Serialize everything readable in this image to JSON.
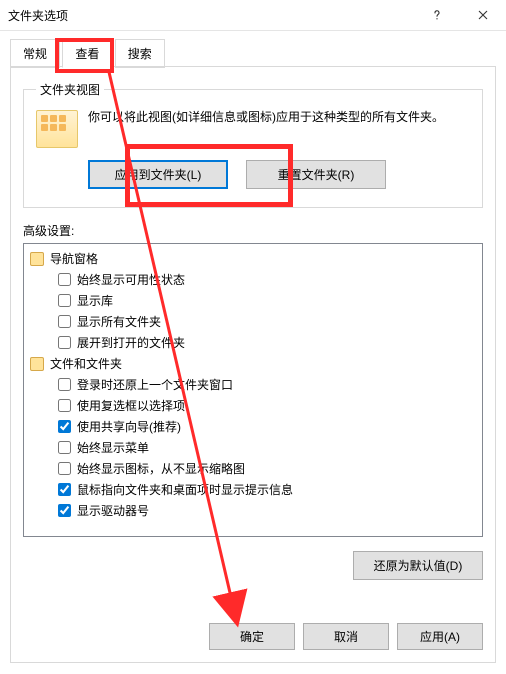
{
  "title": "文件夹选项",
  "tabs": {
    "general": "常规",
    "view": "查看",
    "search": "搜索"
  },
  "folderview": {
    "legend": "文件夹视图",
    "desc": "你可以将此视图(如详细信息或图标)应用于这种类型的所有文件夹。",
    "apply_btn": "应用到文件夹(L)",
    "reset_btn": "重置文件夹(R)"
  },
  "adv_label": "高级设置:",
  "groups": [
    {
      "name": "导航窗格",
      "icon": "nav",
      "items": [
        {
          "label": "始终显示可用性状态",
          "checked": false
        },
        {
          "label": "显示库",
          "checked": false
        },
        {
          "label": "显示所有文件夹",
          "checked": false
        },
        {
          "label": "展开到打开的文件夹",
          "checked": false
        }
      ]
    },
    {
      "name": "文件和文件夹",
      "icon": "ff",
      "items": [
        {
          "label": "登录时还原上一个文件夹窗口",
          "checked": false
        },
        {
          "label": "使用复选框以选择项",
          "checked": false
        },
        {
          "label": "使用共享向导(推荐)",
          "checked": true
        },
        {
          "label": "始终显示菜单",
          "checked": false
        },
        {
          "label": "始终显示图标，从不显示缩略图",
          "checked": false
        },
        {
          "label": "鼠标指向文件夹和桌面项时显示提示信息",
          "checked": true
        },
        {
          "label": "显示驱动器号",
          "checked": true
        }
      ]
    }
  ],
  "restore_btn": "还原为默认值(D)",
  "dlg": {
    "ok": "确定",
    "cancel": "取消",
    "apply": "应用(A)"
  }
}
